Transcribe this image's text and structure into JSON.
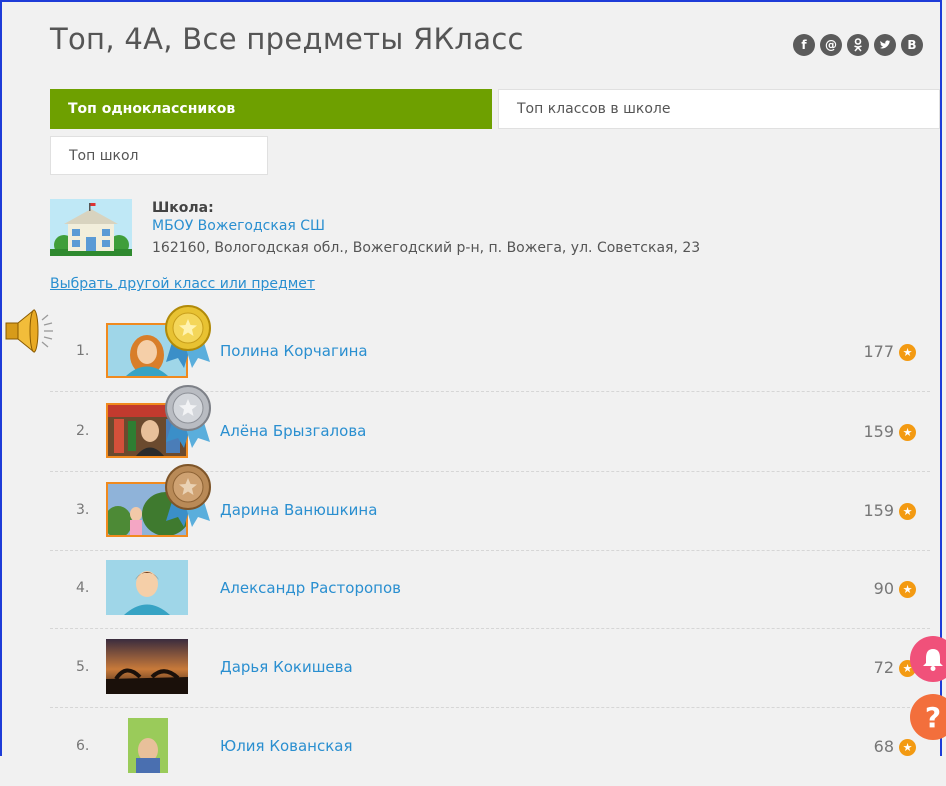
{
  "page": {
    "title": "Топ, 4А, Все предметы ЯКласс"
  },
  "social": [
    {
      "icon": "facebook-icon",
      "glyph": "f"
    },
    {
      "icon": "mailru-icon",
      "glyph": "@"
    },
    {
      "icon": "odnoklassniki-icon",
      "glyph": "ok"
    },
    {
      "icon": "twitter-icon",
      "glyph": "t"
    },
    {
      "icon": "vk-icon",
      "glyph": "B"
    }
  ],
  "tabs": {
    "classmates": "Топ одноклассников",
    "classes": "Топ классов в школе",
    "schools": "Топ школ"
  },
  "school": {
    "label": "Школа:",
    "name": "МБОУ Вожегодская СШ",
    "address": "162160, Вологодская обл., Вожегодский р-н, п. Вожега, ул. Советская, 23"
  },
  "choose_link": "Выбрать другой класс или предмет",
  "colors": {
    "accent_green": "#6ea000",
    "link_blue": "#2a8fd0",
    "star_orange": "#f39a12",
    "bell_pink": "#f0517a",
    "help_orange": "#f36f3c"
  },
  "leaderboard": [
    {
      "rank": "1.",
      "name": "Полина Корчагина",
      "score": "177",
      "medal": "gold"
    },
    {
      "rank": "2.",
      "name": "Алёна Брызгалова",
      "score": "159",
      "medal": "silver"
    },
    {
      "rank": "3.",
      "name": "Дарина Ванюшкина",
      "score": "159",
      "medal": "bronze"
    },
    {
      "rank": "4.",
      "name": "Александр Расторопов",
      "score": "90",
      "medal": ""
    },
    {
      "rank": "5.",
      "name": "Дарья Кокишева",
      "score": "72",
      "medal": ""
    },
    {
      "rank": "6.",
      "name": "Юлия Кованская",
      "score": "68",
      "medal": ""
    }
  ],
  "floating": {
    "help_glyph": "?"
  }
}
